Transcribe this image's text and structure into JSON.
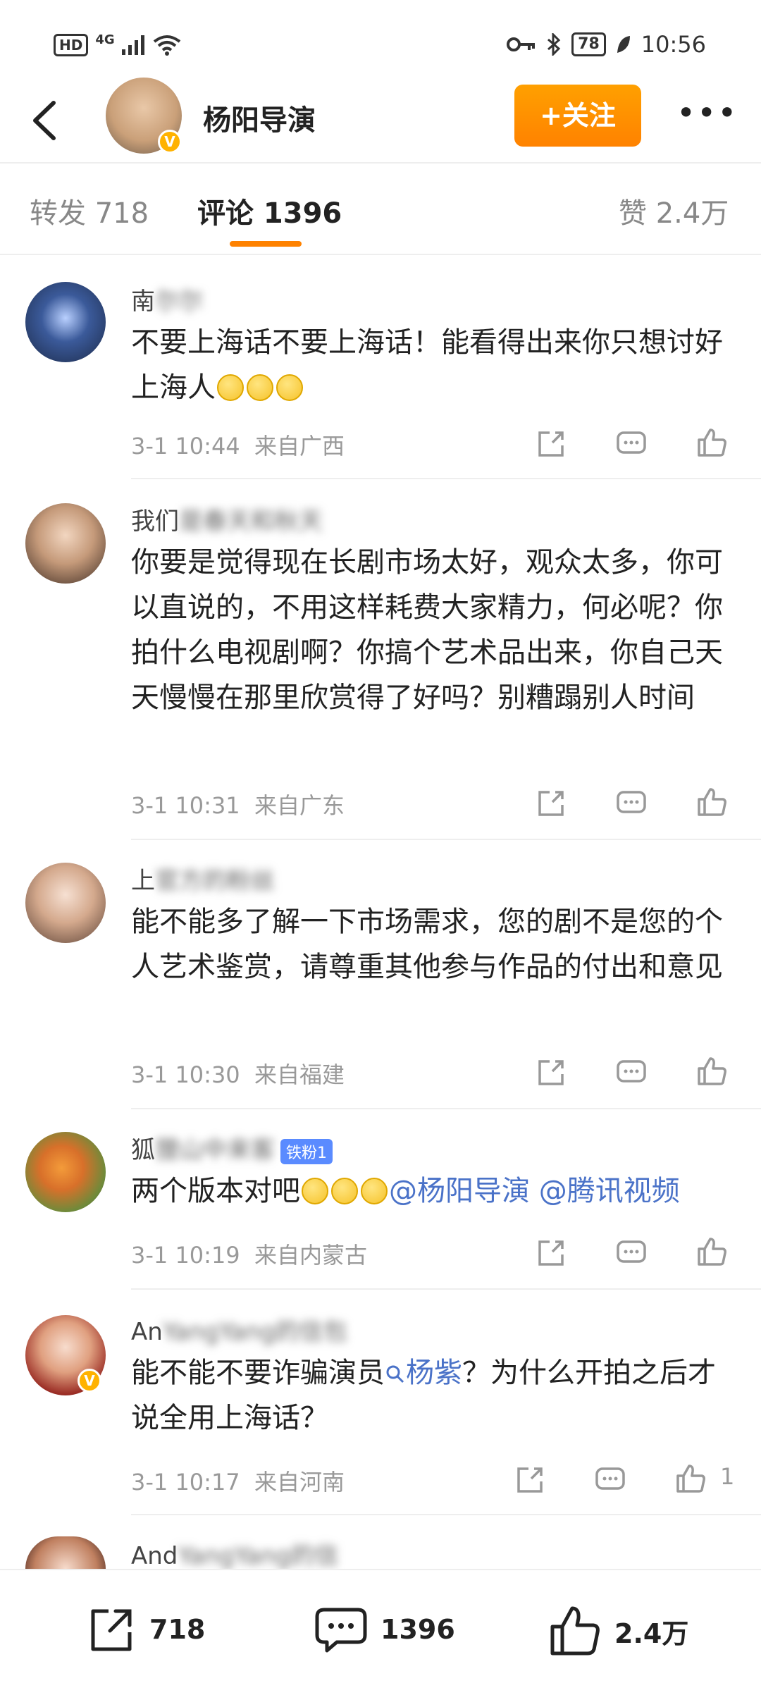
{
  "status_bar": {
    "hd_label": "HD",
    "network_label": "4G",
    "battery_level": "78",
    "time": "10:56"
  },
  "header": {
    "author_name": "杨阳导演",
    "follow_label": "+关注",
    "more_label": "•••"
  },
  "tabs": [
    {
      "label": "转发 718"
    },
    {
      "label": "评论 1396"
    },
    {
      "label": "赞 2.4万"
    }
  ],
  "comments": [
    {
      "name_visible": "南",
      "text": "不要上海话不要上海话！能看得出来你只想讨好上海人",
      "emoji_count": 3,
      "time": "3-1 10:44",
      "location": "来自广西",
      "like_count": ""
    },
    {
      "name_visible": "我们",
      "text": "你要是觉得现在长剧市场太好，观众太多，你可以直说的，不用这样耗费大家精力，何必呢？你拍什么电视剧啊？你搞个艺术品出来，你自己天天慢慢在那里欣赏得了好吗？别糟蹋别人时间",
      "time": "3-1 10:31",
      "location": "来自广东",
      "like_count": ""
    },
    {
      "name_visible": "上",
      "text": "能不能多了解一下市场需求，您的剧不是您的个人艺术鉴赏，请尊重其他参与作品的付出和意见",
      "time": "3-1 10:30",
      "location": "来自福建",
      "like_count": ""
    },
    {
      "name_visible": "狐",
      "fan_badge": "铁粉1",
      "text_prefix": "两个版本对吧",
      "mention_1": "@杨阳导演",
      "mention_2": "@腾讯视频",
      "time": "3-1 10:19",
      "location": "来自内蒙古",
      "like_count": ""
    },
    {
      "name_visible": "An",
      "text_prefix": "能不能不要诈骗演员",
      "topic": "杨紫",
      "text_suffix": "？为什么开拍之后才说全用上海话？",
      "time": "3-1 10:17",
      "location": "来自河南",
      "like_count": "1"
    },
    {
      "name_visible": "And"
    }
  ],
  "bottom_bar": {
    "repost_count": "718",
    "comment_count": "1396",
    "like_count": "2.4万"
  },
  "colors": {
    "accent": "#ff8200",
    "link": "#4a72c8",
    "verified": "#ffb200"
  }
}
